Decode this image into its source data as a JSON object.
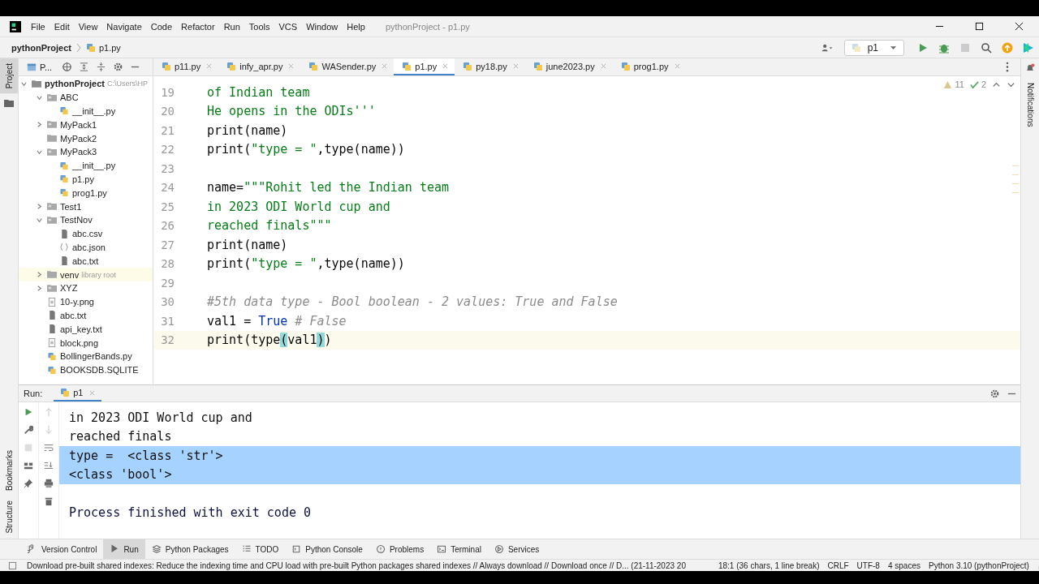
{
  "menu": [
    "File",
    "Edit",
    "View",
    "Navigate",
    "Code",
    "Refactor",
    "Run",
    "Tools",
    "VCS",
    "Window",
    "Help"
  ],
  "window": {
    "title": "pythonProject - p1.py"
  },
  "breadcrumb": {
    "project": "pythonProject",
    "file": "p1.py"
  },
  "run_config": "p1",
  "left_stripe": [
    {
      "label": "Project",
      "selected": true
    }
  ],
  "left_stripe_bottom": [
    "Bookmarks",
    "Structure"
  ],
  "right_stripe": [
    "Notifications"
  ],
  "project_panel": {
    "label": "P...",
    "tree": [
      {
        "name": "pythonProject",
        "hint": "C:\\Users\\HP",
        "kind": "root",
        "expanded": true,
        "children": [
          {
            "name": "ABC",
            "kind": "folder",
            "expanded": true,
            "children": [
              {
                "name": "__init__.py",
                "kind": "py"
              }
            ]
          },
          {
            "name": "MyPack1",
            "kind": "folder",
            "expanded": false
          },
          {
            "name": "MyPack2",
            "kind": "plainfolder"
          },
          {
            "name": "MyPack3",
            "kind": "folder",
            "expanded": true,
            "children": [
              {
                "name": "__init__.py",
                "kind": "py"
              },
              {
                "name": "p1.py",
                "kind": "py"
              },
              {
                "name": "prog1.py",
                "kind": "py"
              }
            ]
          },
          {
            "name": "Test1",
            "kind": "folder",
            "expanded": false
          },
          {
            "name": "TestNov",
            "kind": "folder",
            "expanded": true,
            "children": [
              {
                "name": "abc.csv",
                "kind": "file"
              },
              {
                "name": "abc.json",
                "kind": "json"
              },
              {
                "name": "abc.txt",
                "kind": "file"
              }
            ]
          },
          {
            "name": "venv",
            "hint": "library root",
            "kind": "library",
            "expanded": false
          },
          {
            "name": "XYZ",
            "kind": "folder",
            "expanded": false
          },
          {
            "name": "10-y.png",
            "kind": "image"
          },
          {
            "name": "abc.txt",
            "kind": "file"
          },
          {
            "name": "api_key.txt",
            "kind": "file"
          },
          {
            "name": "block.png",
            "kind": "image"
          },
          {
            "name": "BollingerBands.py",
            "kind": "py"
          },
          {
            "name": "BOOKSDB.SQLITE",
            "kind": "py"
          }
        ]
      }
    ]
  },
  "tabs": [
    {
      "label": "p11.py",
      "selected": false
    },
    {
      "label": "infy_apr.py",
      "selected": false
    },
    {
      "label": "WASender.py",
      "selected": false
    },
    {
      "label": "p1.py",
      "selected": true
    },
    {
      "label": "py18.py",
      "selected": false
    },
    {
      "label": "june2023.py",
      "selected": false
    },
    {
      "label": "prog1.py",
      "selected": false
    }
  ],
  "inspections": {
    "warnings": "11",
    "checks": "2"
  },
  "code": [
    {
      "number": "19",
      "current": false,
      "segments": [
        {
          "text": "of Indian team",
          "kind": "string"
        }
      ]
    },
    {
      "number": "20",
      "current": false,
      "segments": [
        {
          "text": "He opens in the ODIs'''",
          "kind": "string"
        }
      ]
    },
    {
      "number": "21",
      "current": false,
      "segments": [
        {
          "text": "print(name)",
          "kind": "plain"
        }
      ]
    },
    {
      "number": "22",
      "current": false,
      "segments": [
        {
          "text": "print(",
          "kind": "plain"
        },
        {
          "text": "\"type = \"",
          "kind": "string"
        },
        {
          "text": ",type(name))",
          "kind": "plain"
        }
      ]
    },
    {
      "number": "23",
      "current": false
    },
    {
      "number": "24",
      "current": false,
      "segments": [
        {
          "text": "name=",
          "kind": "plain"
        },
        {
          "text": "\"\"\"Rohit led the Indian team",
          "kind": "string"
        }
      ]
    },
    {
      "number": "25",
      "current": false,
      "segments": [
        {
          "text": "in 2023 ODI World cup and",
          "kind": "string"
        }
      ]
    },
    {
      "number": "26",
      "current": false,
      "segments": [
        {
          "text": "reached finals\"\"\"",
          "kind": "string"
        }
      ]
    },
    {
      "number": "27",
      "current": false,
      "segments": [
        {
          "text": "print(name)",
          "kind": "plain"
        }
      ]
    },
    {
      "number": "28",
      "current": false,
      "segments": [
        {
          "text": "print(",
          "kind": "plain"
        },
        {
          "text": "\"type = \"",
          "kind": "string"
        },
        {
          "text": ",type(name))",
          "kind": "plain"
        }
      ]
    },
    {
      "number": "29",
      "current": false
    },
    {
      "number": "30",
      "current": false,
      "segments": [
        {
          "text": "#5th data type - Bool boolean - 2 values: True and False",
          "kind": "comment"
        }
      ]
    },
    {
      "number": "31",
      "current": false,
      "segments": [
        {
          "text": "val1 = ",
          "kind": "plain"
        },
        {
          "text": "True",
          "kind": "keyword"
        },
        {
          "text": " # False",
          "kind": "comment"
        }
      ]
    },
    {
      "number": "32",
      "current": true,
      "segments": [
        {
          "text": "print(type",
          "kind": "plain"
        },
        {
          "text": "(",
          "kind": "match"
        },
        {
          "text": "val1",
          "kind": "plain"
        },
        {
          "text": ")",
          "kind": "match"
        },
        {
          "text": ")",
          "kind": "plain"
        }
      ]
    }
  ],
  "run_panel": {
    "label": "Run:",
    "tab": "p1",
    "lines": [
      {
        "text": "in 2023 ODI World cup and",
        "kind": "output",
        "selected": false
      },
      {
        "text": "reached finals",
        "kind": "output",
        "selected": false
      },
      {
        "text": "type =  <class 'str'>",
        "kind": "output",
        "selected": true
      },
      {
        "text": "<class 'bool'>",
        "kind": "output",
        "selected": true
      },
      {
        "text": "Process finished with exit code 0",
        "kind": "exit",
        "selected": false
      }
    ]
  },
  "tool_tabs": [
    {
      "label": "Version Control",
      "selected": false
    },
    {
      "label": "Run",
      "selected": true
    },
    {
      "label": "Python Packages",
      "selected": false
    },
    {
      "label": "TODO",
      "selected": false
    },
    {
      "label": "Python Console",
      "selected": false
    },
    {
      "label": "Problems",
      "selected": false
    },
    {
      "label": "Terminal",
      "selected": false
    },
    {
      "label": "Services",
      "selected": false
    }
  ],
  "status_bar": {
    "message": "Download pre-built shared indexes: Reduce the indexing time and CPU load with pre-built Python packages shared indexes // Always download // Download once // D... (21-11-2023 20",
    "items": [
      "18:1 (36 chars, 1 line break)",
      "CRLF",
      "UTF-8",
      "4 spaces",
      "Python 3.10 (pythonProject)"
    ]
  }
}
